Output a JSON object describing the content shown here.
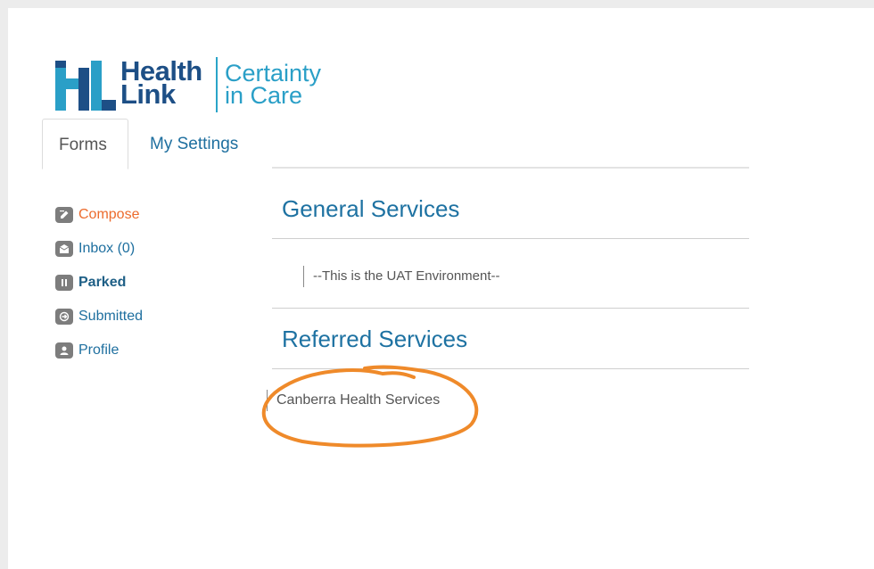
{
  "logo": {
    "brand_line1": "Health",
    "brand_line2": "Link",
    "tagline_line1": "Certainty",
    "tagline_line2": "in Care"
  },
  "tabs": [
    {
      "label": "Forms",
      "active": true
    },
    {
      "label": "My Settings",
      "active": false
    }
  ],
  "sidebar": {
    "items": [
      {
        "label": "Compose",
        "icon": "compose-icon"
      },
      {
        "label": "Inbox (0)",
        "icon": "inbox-icon"
      },
      {
        "label": "Parked",
        "icon": "pause-icon"
      },
      {
        "label": "Submitted",
        "icon": "submit-icon"
      },
      {
        "label": "Profile",
        "icon": "profile-icon"
      }
    ]
  },
  "main": {
    "general_title": "General Services",
    "environment_note": "--This is the UAT Environment--",
    "referred_title": "Referred Services",
    "referred_services": [
      "Canberra Health Services"
    ]
  },
  "colors": {
    "brand_dark": "#1d4f86",
    "brand_light": "#2a9fc7",
    "link": "#1e6f9f",
    "compose": "#ec6b2d",
    "annotation": "#ef8a2a"
  }
}
